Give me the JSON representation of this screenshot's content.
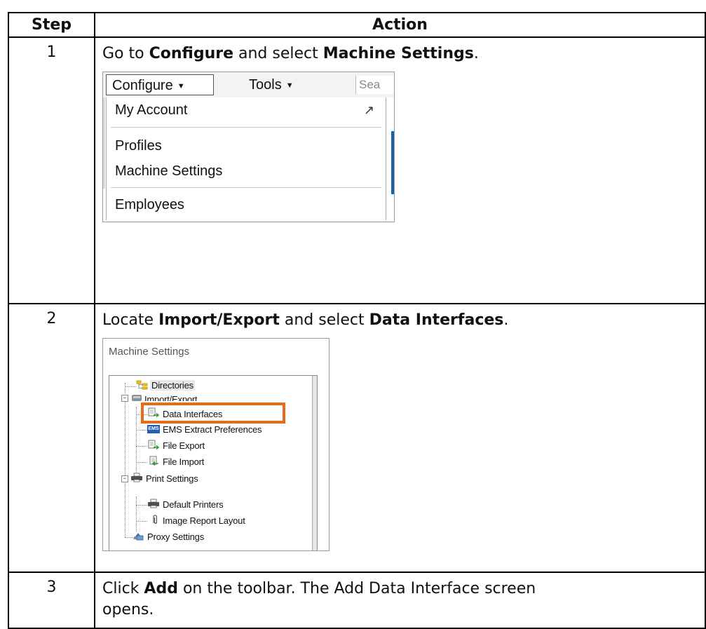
{
  "table": {
    "header_step": "Step",
    "header_action": "Action"
  },
  "rows": [
    {
      "step": "1",
      "text_pre": "Go to ",
      "bold1": "Configure",
      "text_mid": " and select ",
      "bold2": "Machine Settings",
      "text_post": "."
    },
    {
      "step": "2",
      "text_pre": "Locate ",
      "bold1": "Import/Export",
      "text_mid": " and select ",
      "bold2": "Data Interfaces",
      "text_post": "."
    },
    {
      "step": "3",
      "text_pre": "Click ",
      "bold1": "Add",
      "text_post": " on the toolbar.  The Add Data Interface screen opens."
    }
  ],
  "screenshot1": {
    "configure_label": "Configure",
    "tools_label": "Tools",
    "search_text": "Sea",
    "menu_items": [
      "My Account",
      "Profiles",
      "Machine Settings",
      "Employees"
    ],
    "icons": [
      "chevron-down-icon",
      "external-arrow-icon"
    ]
  },
  "screenshot2": {
    "title": "Machine Settings",
    "tree": [
      "Directories",
      "Import/Export",
      "Data Interfaces",
      "EMS Extract Preferences",
      "File Export",
      "File Import",
      "Print Settings",
      "Default Printers",
      "Image Report Layout",
      "Proxy Settings"
    ],
    "ems_badge": "EMS",
    "highlight_color": "#e26d1b"
  }
}
